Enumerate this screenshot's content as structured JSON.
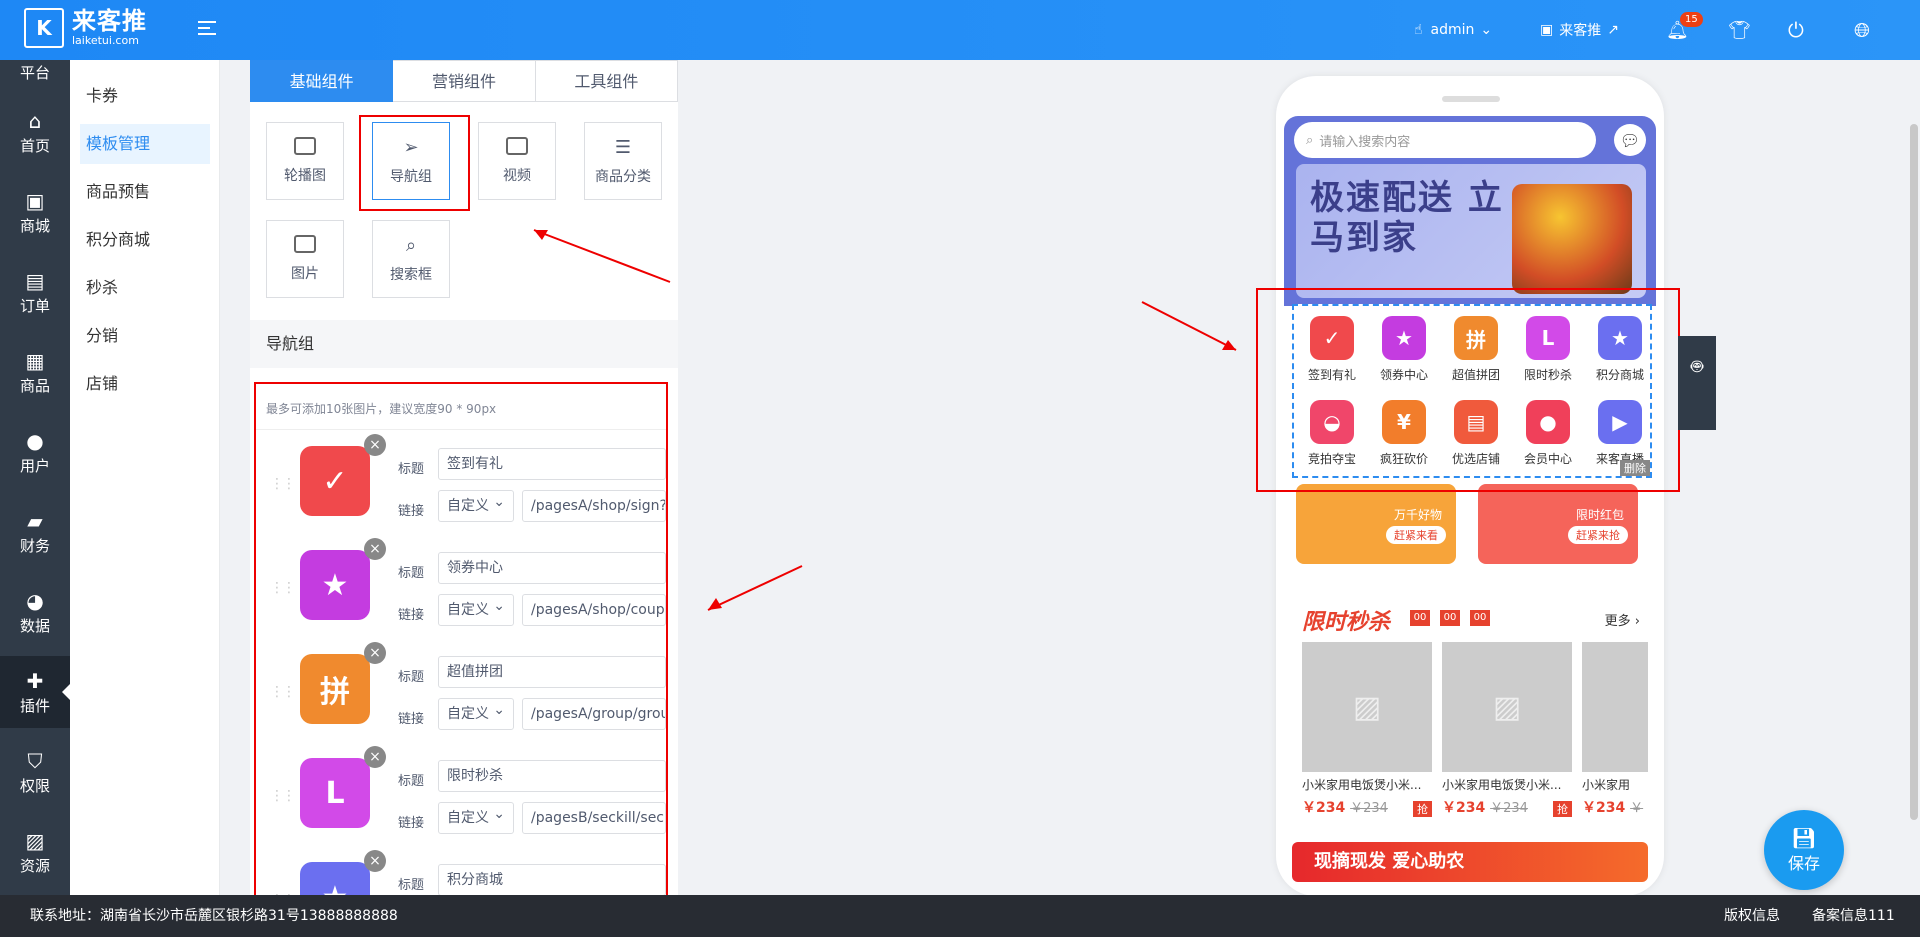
{
  "header": {
    "logo_mark": "K",
    "logo_name": "来客推",
    "logo_domain": "laiketui.com",
    "user": "admin",
    "store": "来客推",
    "notification_count": "15"
  },
  "sidebar": {
    "items": [
      {
        "label": "平台",
        "icon": "platform-icon"
      },
      {
        "label": "首页",
        "icon": "home-icon"
      },
      {
        "label": "商城",
        "icon": "mall-icon"
      },
      {
        "label": "订单",
        "icon": "order-icon"
      },
      {
        "label": "商品",
        "icon": "goods-icon"
      },
      {
        "label": "用户",
        "icon": "user-icon"
      },
      {
        "label": "财务",
        "icon": "wallet-icon"
      },
      {
        "label": "数据",
        "icon": "chart-icon"
      },
      {
        "label": "插件",
        "icon": "puzzle-icon"
      },
      {
        "label": "权限",
        "icon": "shield-icon"
      },
      {
        "label": "资源",
        "icon": "image-icon"
      }
    ]
  },
  "submenu": {
    "items": [
      "卡券",
      "模板管理",
      "商品预售",
      "积分商城",
      "秒杀",
      "分销",
      "店铺"
    ]
  },
  "panel": {
    "tabs": [
      "基础组件",
      "营销组件",
      "工具组件"
    ],
    "components": [
      "轮播图",
      "导航组",
      "视频",
      "商品分类",
      "图片",
      "搜索框"
    ],
    "section_title": "导航组",
    "hint": "最多可添加10张图片，建议宽度90 * 90px",
    "title_label": "标题",
    "link_label": "链接",
    "nav_items": [
      {
        "title": "签到有礼",
        "link_type": "自定义",
        "link": "/pagesA/shop/sign?r",
        "glyph": "✓",
        "color": "#f0494c"
      },
      {
        "title": "领券中心",
        "link_type": "自定义",
        "link": "/pagesA/shop/coupo",
        "glyph": "★",
        "color": "#c43ce0"
      },
      {
        "title": "超值拼团",
        "link_type": "自定义",
        "link": "/pagesA/group/group",
        "glyph": "拼",
        "color": "#f08a2e"
      },
      {
        "title": "限时秒杀",
        "link_type": "自定义",
        "link": "/pagesB/seckill/secki",
        "glyph": "L",
        "color": "#d24ae8"
      },
      {
        "title": "积分商城",
        "link_type": "",
        "link": "",
        "glyph": "★",
        "color": "#6b6ff0"
      }
    ]
  },
  "preview": {
    "search_placeholder": "请输入搜索内容",
    "banner_text": "极速配送 立马到家",
    "nav": [
      {
        "label": "签到有礼",
        "glyph": "✓",
        "color": "#f0494c"
      },
      {
        "label": "领券中心",
        "glyph": "★",
        "color": "#c43ce0"
      },
      {
        "label": "超值拼团",
        "glyph": "拼",
        "color": "#f08a2e"
      },
      {
        "label": "限时秒杀",
        "glyph": "L",
        "color": "#d24ae8"
      },
      {
        "label": "积分商城",
        "glyph": "★",
        "color": "#6b6ff0"
      },
      {
        "label": "竞拍夺宝",
        "glyph": "◒",
        "color": "#f0466a"
      },
      {
        "label": "疯狂砍价",
        "glyph": "¥",
        "color": "#f27d2b"
      },
      {
        "label": "优选店铺",
        "glyph": "▤",
        "color": "#f05a3c"
      },
      {
        "label": "会员中心",
        "glyph": "●",
        "color": "#f0405a"
      },
      {
        "label": "来客直播",
        "glyph": "▶",
        "color": "#6a6ff0"
      }
    ],
    "delete_tag": "删除",
    "promo": [
      {
        "title": "万千好物",
        "button": "赶紧来看",
        "color": "#f7a43a"
      },
      {
        "title": "限时红包",
        "button": "赶紧来抢",
        "color": "#f5645a"
      }
    ],
    "seckill": {
      "title": "限时秒杀",
      "timer": [
        "00",
        "00",
        "00"
      ],
      "more": "更多 ›",
      "products": [
        {
          "name": "小米家用电饭煲小米...",
          "price": "￥234",
          "old": "￥234",
          "buy": "抢"
        },
        {
          "name": "小米家用电饭煲小米...",
          "price": "￥234",
          "old": "￥234",
          "buy": "抢"
        },
        {
          "name": "小米家用",
          "price": "￥234",
          "old": "￥",
          "buy": ""
        }
      ]
    },
    "bottom_banner": "现摘现发 爱心助农"
  },
  "save_label": "保存",
  "footer": {
    "address": "联系地址：湖南省长沙市岳麓区银杉路31号13888888888",
    "copyright": "版权信息",
    "icp": "备案信息111"
  }
}
